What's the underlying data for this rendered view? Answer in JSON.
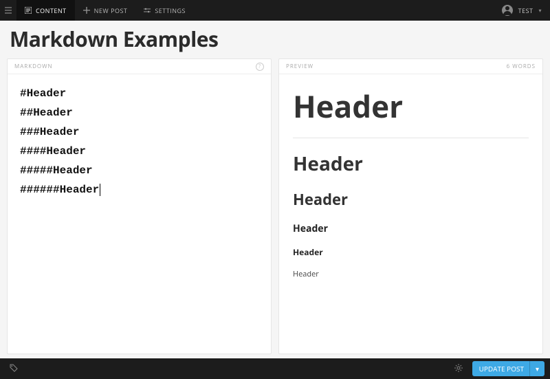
{
  "topbar": {
    "nav": {
      "content": "CONTENT",
      "new_post": "NEW POST",
      "settings": "SETTINGS"
    },
    "user": {
      "name": "TEST"
    }
  },
  "post": {
    "title": "Markdown Examples"
  },
  "panels": {
    "markdown": {
      "label": "MARKDOWN"
    },
    "preview": {
      "label": "PREVIEW",
      "wordcount": "6 WORDS"
    }
  },
  "markdown_source": {
    "line1": "#Header",
    "line2": "##Header",
    "line3": "###Header",
    "line4": "####Header",
    "line5": "#####Header",
    "line6": "######Header"
  },
  "preview_render": {
    "h1": "Header",
    "h2": "Header",
    "h3": "Header",
    "h4": "Header",
    "h5": "Header",
    "h6": "Header"
  },
  "footer": {
    "update_btn": "UPDATE POST"
  }
}
